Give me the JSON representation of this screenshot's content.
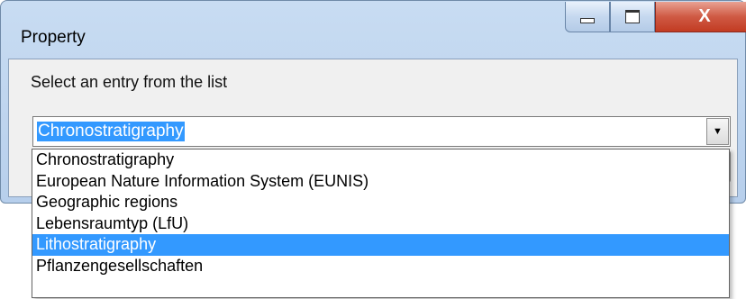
{
  "window": {
    "title": "Property",
    "controls": {
      "minimize": "minimize",
      "maximize": "maximize",
      "close": "X"
    }
  },
  "prompt": "Select an entry from the list",
  "combo": {
    "value": "Chronostratigraphy",
    "options": [
      "Chronostratigraphy",
      "European Nature Information System (EUNIS)",
      "Geographic regions",
      "Lebensraumtyp (LfU)",
      "Lithostratigraphy",
      "Pflanzengesellschaften"
    ],
    "highlighted_option": "Lithostratigraphy"
  }
}
